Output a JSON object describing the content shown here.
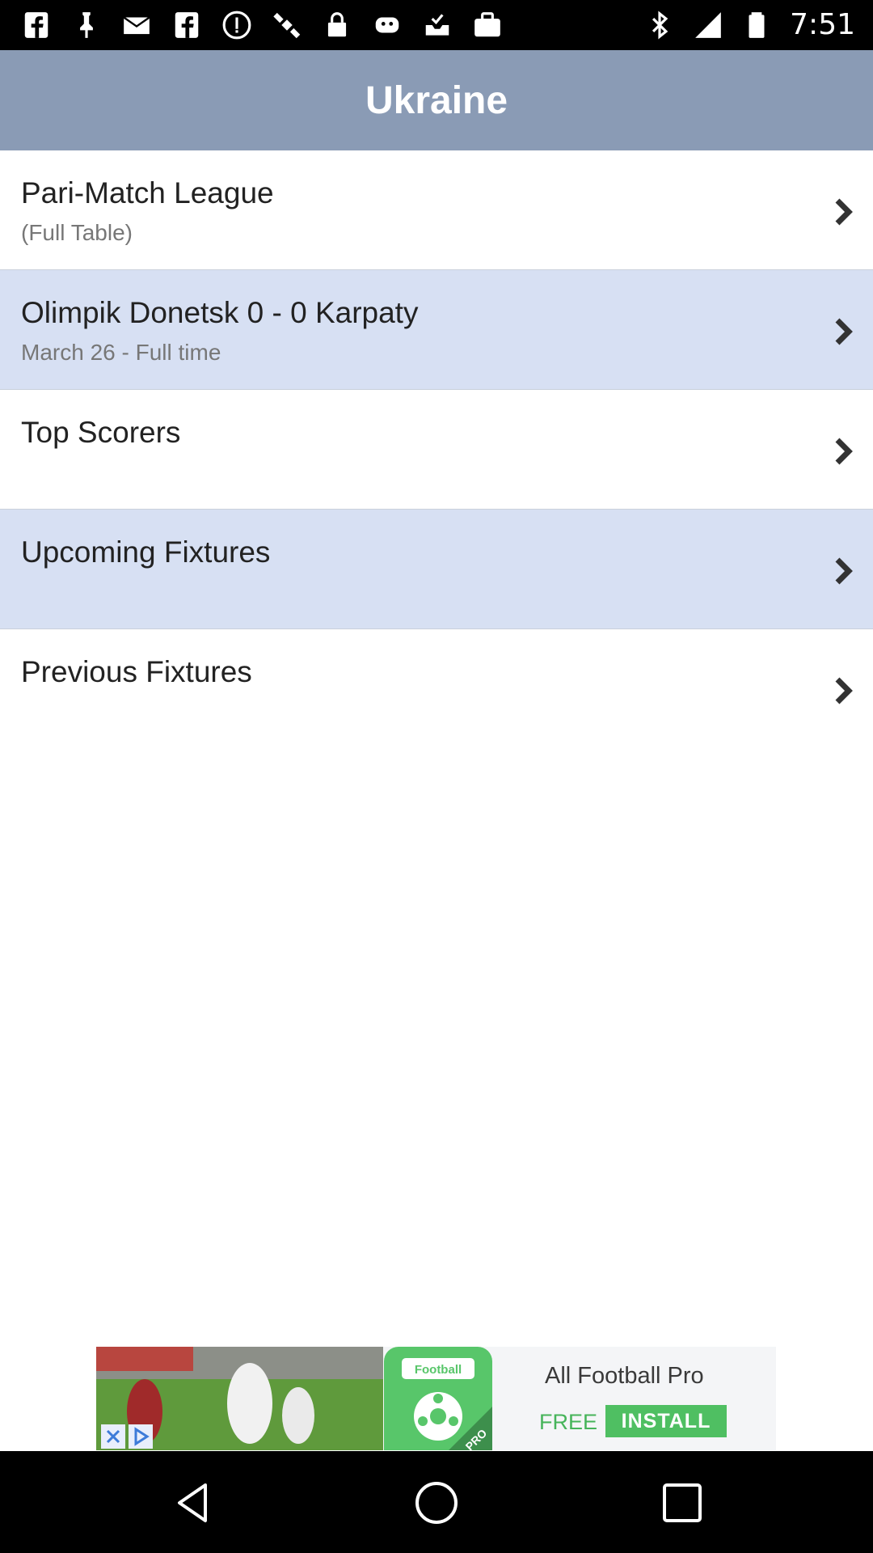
{
  "status_bar": {
    "time": "7:51",
    "left_icons": [
      "facebook-icon",
      "pin-icon",
      "mail-icon",
      "facebook-icon",
      "info-icon",
      "satellite-icon",
      "lock-icon",
      "android-icon",
      "inbox-check-icon",
      "briefcase-icon"
    ],
    "right_icons": [
      "bluetooth-icon",
      "signal-icon",
      "battery-icon"
    ]
  },
  "header": {
    "title": "Ukraine"
  },
  "menu": {
    "items": [
      {
        "title": "Pari-Match League",
        "subtitle": "(Full Table)"
      },
      {
        "title": "Olimpik Donetsk 0 - 0 Karpaty",
        "subtitle": "March 26 - Full time"
      },
      {
        "title": "Top Scorers",
        "subtitle": ""
      },
      {
        "title": "Upcoming Fixtures",
        "subtitle": ""
      },
      {
        "title": "Previous Fixtures",
        "subtitle": ""
      }
    ]
  },
  "ad": {
    "app_icon_text": "Football",
    "app_badge": "PRO",
    "title": "All Football Pro",
    "free_label": "FREE",
    "install_label": "INSTALL"
  },
  "colors": {
    "header_bg": "#8a9bb5",
    "alt_row_bg": "#d7e0f3",
    "ad_green": "#4fbf62"
  }
}
